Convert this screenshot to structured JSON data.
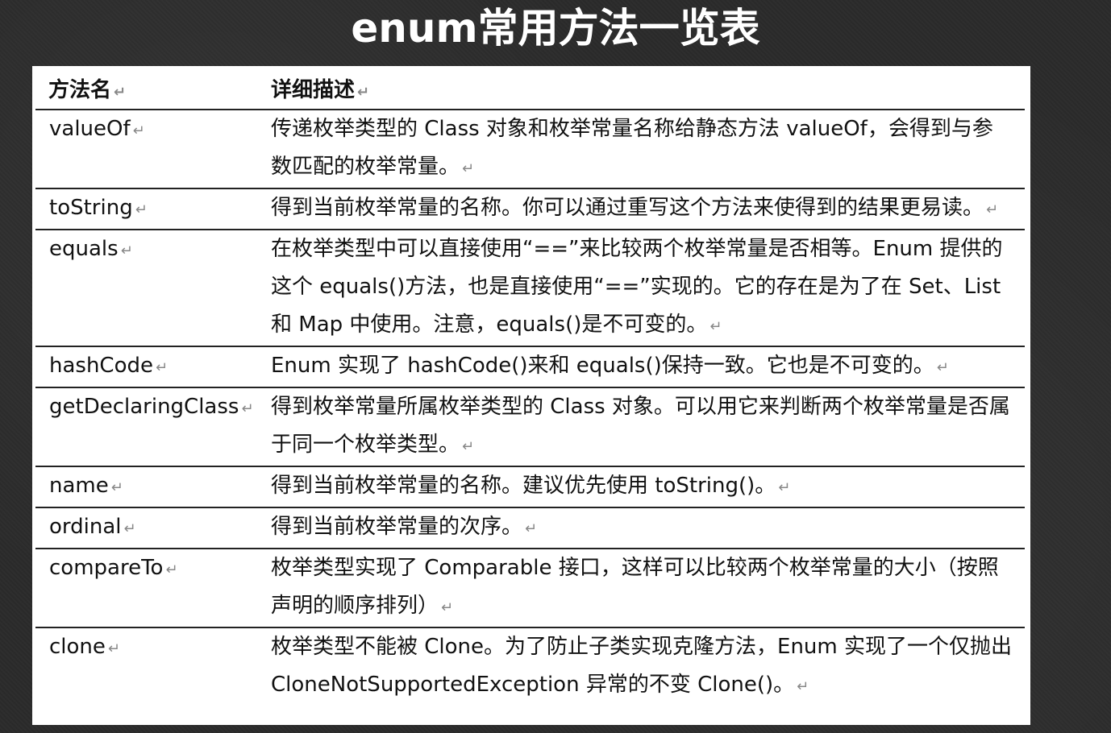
{
  "slide": {
    "title": "enum常用方法一览表"
  },
  "table": {
    "header": {
      "name": "方法名",
      "description": "详细描述"
    },
    "return_mark": "↵",
    "rows": [
      {
        "name": "valueOf",
        "description": "传递枚举类型的 Class 对象和枚举常量名称给静态方法 valueOf，会得到与参数匹配的枚举常量。"
      },
      {
        "name": "toString",
        "description": "得到当前枚举常量的名称。你可以通过重写这个方法来使得到的结果更易读。"
      },
      {
        "name": "equals",
        "description": "在枚举类型中可以直接使用“==”来比较两个枚举常量是否相等。Enum 提供的这个 equals()方法，也是直接使用“==”实现的。它的存在是为了在 Set、List 和 Map 中使用。注意，equals()是不可变的。"
      },
      {
        "name": "hashCode",
        "description": "Enum 实现了 hashCode()来和 equals()保持一致。它也是不可变的。"
      },
      {
        "name": "getDeclaringClass",
        "description": "得到枚举常量所属枚举类型的 Class 对象。可以用它来判断两个枚举常量是否属于同一个枚举类型。"
      },
      {
        "name": "name",
        "description": "得到当前枚举常量的名称。建议优先使用 toString()。"
      },
      {
        "name": "ordinal",
        "description": "得到当前枚举常量的次序。"
      },
      {
        "name": "compareTo",
        "description": "枚举类型实现了 Comparable 接口，这样可以比较两个枚举常量的大小（按照声明的顺序排列）"
      },
      {
        "name": "clone",
        "description": "枚举类型不能被 Clone。为了防止子类实现克隆方法，Enum 实现了一个仅抛出 CloneNotSupportedException 异常的不变 Clone()。"
      }
    ]
  }
}
